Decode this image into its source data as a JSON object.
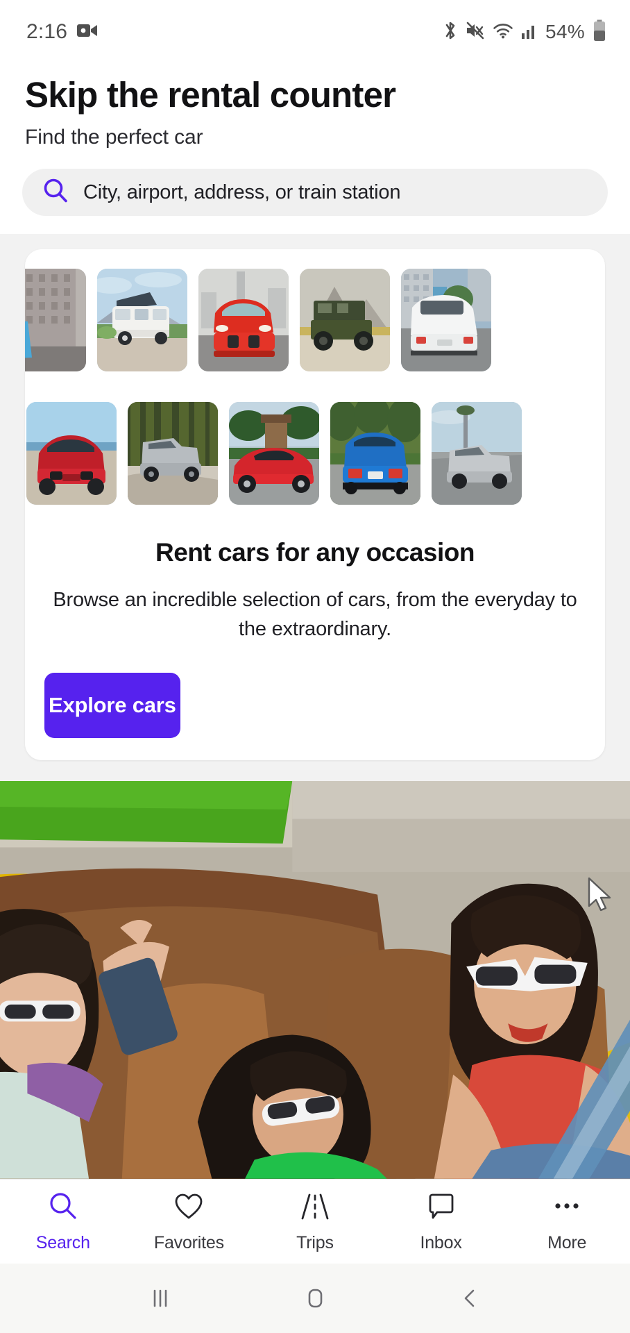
{
  "statusbar": {
    "time": "2:16",
    "battery_percent": "54%",
    "icons": [
      "video-camera-icon",
      "bluetooth-icon",
      "mute-icon",
      "wifi-icon",
      "cellular-signal-icon",
      "battery-icon"
    ]
  },
  "header": {
    "title": "Skip the rental counter",
    "subtitle": "Find the perfect car"
  },
  "search": {
    "placeholder": "City, airport, address, or train station",
    "value": "",
    "icon": "search-icon",
    "accent": "#5622ee"
  },
  "promo_card": {
    "title": "Rent cars for any occasion",
    "description": "Browse an incredible selection of cars, from the everyday to the extraordinary.",
    "cta_label": "Explore cars",
    "cta_color": "#5622ee",
    "gallery_row_1": [
      {
        "name": "blue-sports-car-city"
      },
      {
        "name": "white-camper-van-mountains"
      },
      {
        "name": "red-suv-front-city"
      },
      {
        "name": "green-off-road-suv-desert"
      },
      {
        "name": "white-hatchback-city"
      }
    ],
    "gallery_row_2": [
      {
        "name": "red-convertible-beach"
      },
      {
        "name": "silver-pickup-truck-forest"
      },
      {
        "name": "red-sports-car-palms"
      },
      {
        "name": "blue-muscle-car-rear-palms"
      },
      {
        "name": "silver-truck-coastal-road"
      }
    ]
  },
  "hero": {
    "name": "three-women-in-yellow-vintage-convertible"
  },
  "tabbar": {
    "active": "Search",
    "items": [
      {
        "label": "Search",
        "icon": "search-icon"
      },
      {
        "label": "Favorites",
        "icon": "heart-icon"
      },
      {
        "label": "Trips",
        "icon": "road-icon"
      },
      {
        "label": "Inbox",
        "icon": "chat-bubble-icon"
      },
      {
        "label": "More",
        "icon": "ellipsis-icon"
      }
    ]
  },
  "androidnav": {
    "recents": "recents-icon",
    "home": "home-icon",
    "back": "back-icon"
  }
}
